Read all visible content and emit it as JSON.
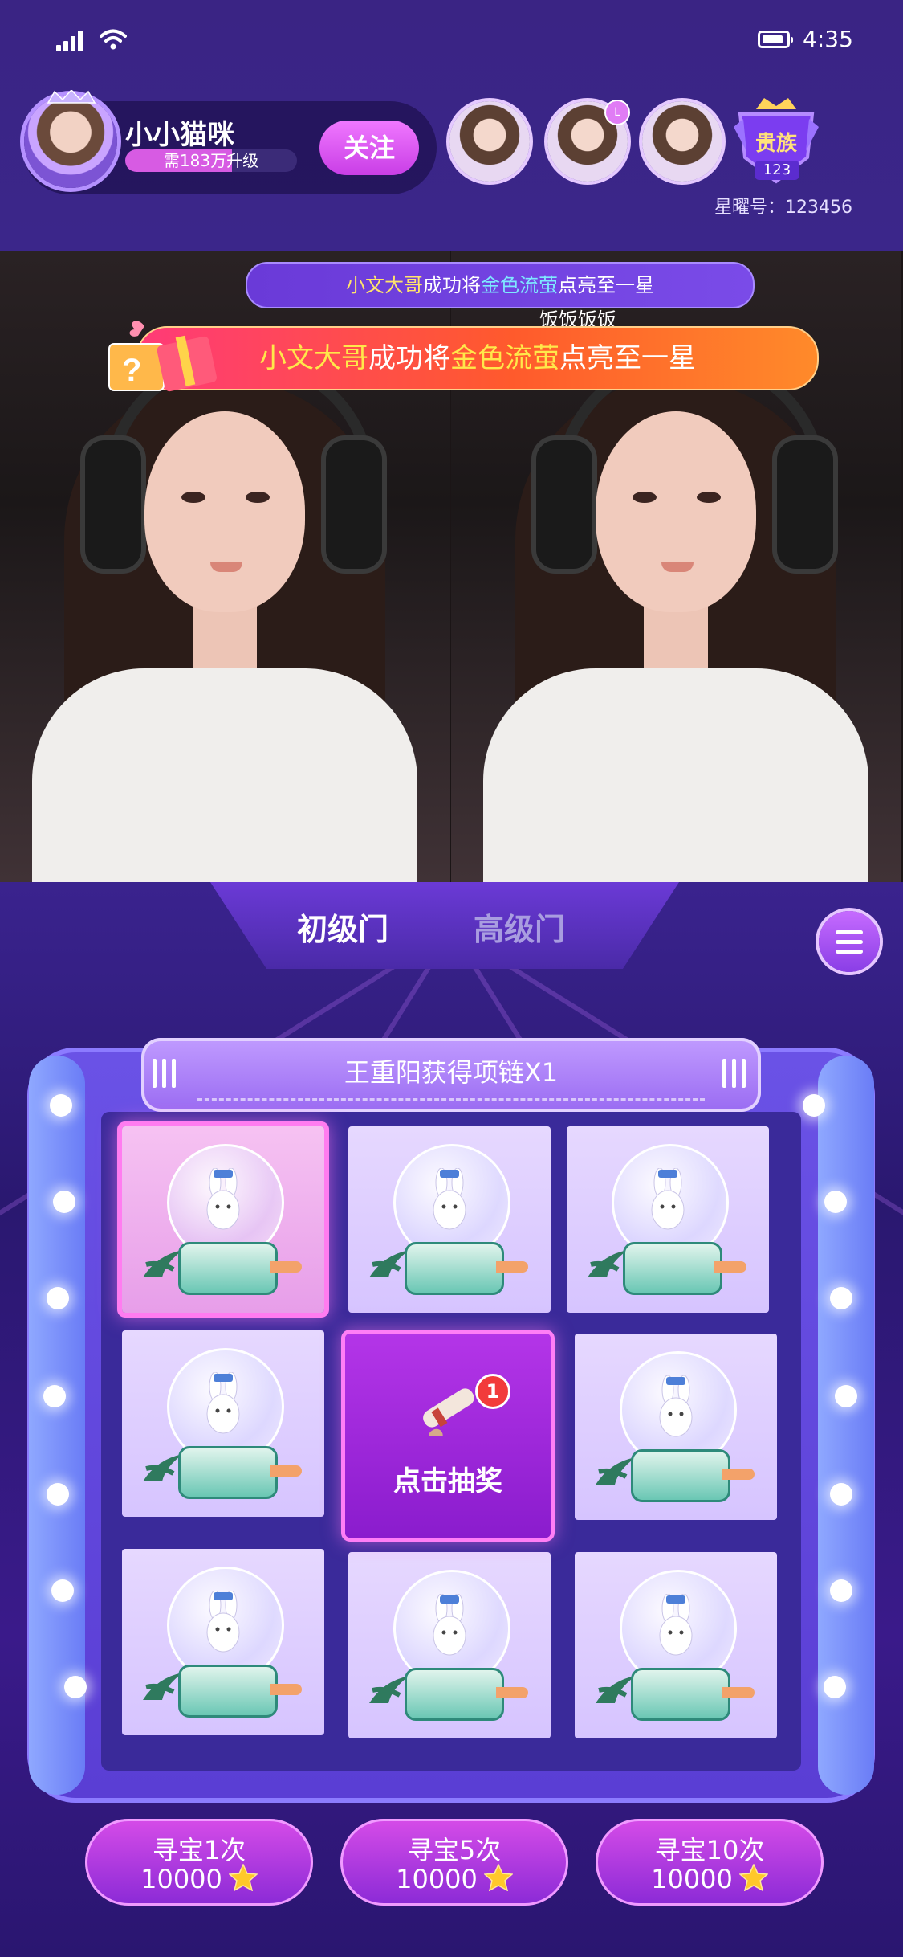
{
  "status_bar": {
    "time": "4:35"
  },
  "host": {
    "name": "小小猫咪",
    "upgrade_text": "需183万升级",
    "upgrade_progress": 0.62,
    "follow_label": "关注"
  },
  "noble": {
    "label": "贵族",
    "level": "123",
    "star_id": "星曜号：123456"
  },
  "ticker_small": {
    "user": "小文大哥",
    "text1": "成功将",
    "item": "金色流萤",
    "text2": "点亮至一星"
  },
  "ticker_big": {
    "user": "小文大哥",
    "text1": "成功将",
    "item": "金色流萤",
    "text2": "点亮至一星"
  },
  "feed_label": "饭饭饭饭",
  "tabs": [
    {
      "label": "初级门",
      "active": true
    },
    {
      "label": "高级门",
      "active": false
    }
  ],
  "marquee": {
    "text": "王重阳获得项链X1"
  },
  "draw_button": {
    "label": "点击抽奖",
    "badge": "1"
  },
  "prize_item_icon": "bunny-cake-globe-icon",
  "buy_options": [
    {
      "label": "寻宝1次",
      "cost": "10000"
    },
    {
      "label": "寻宝5次",
      "cost": "10000"
    },
    {
      "label": "寻宝10次",
      "cost": "10000"
    }
  ],
  "colors": {
    "accent": "#c93ee6",
    "panel": "#2a1870",
    "ticker": "#ff5a2c",
    "highlight": "#ffe84a"
  }
}
